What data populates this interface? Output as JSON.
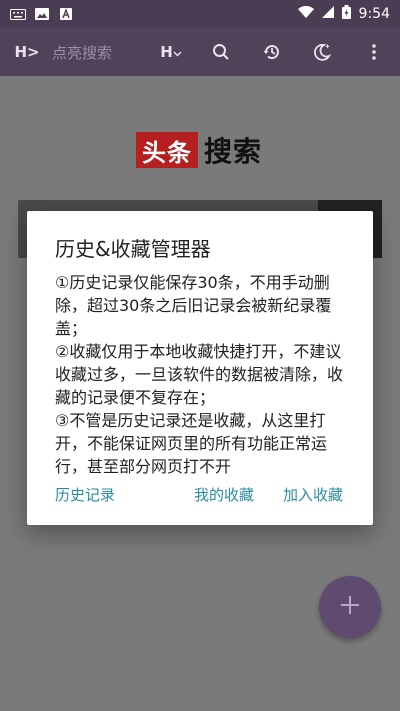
{
  "status_bar": {
    "time": "9:54",
    "left_icons": [
      "keyboard-icon",
      "image-icon",
      "text-a-icon"
    ],
    "right_icons": [
      "wifi-icon",
      "signal-icon",
      "battery-charging-icon"
    ]
  },
  "toolbar": {
    "site_button_label": "H>",
    "search_placeholder": "点亮搜索",
    "heading_button_label": "H",
    "icons": [
      "search-icon",
      "history-icon",
      "night-mode-icon",
      "more-icon"
    ]
  },
  "main": {
    "logo_box": "头条",
    "logo_text": "搜索"
  },
  "dialog": {
    "title": "历史&收藏管理器",
    "body": "①历史记录仅能保存30条，不用手动删除，超过30条之后旧记录会被新纪录覆盖；\n②收藏仅用于本地收藏快捷打开，不建议收藏过多，一旦该软件的数据被清除，收藏的记录便不复存在；\n③不管是历史记录还是收藏，从这里打开，不能保证网页里的所有功能正常运行，甚至部分网页打不开",
    "buttons": {
      "history": "历史记录",
      "favorites": "我的收藏",
      "add_favorite": "加入收藏"
    }
  },
  "colors": {
    "status_bar": "#4a3d53",
    "toolbar": "#514159",
    "accent": "#2a8fa0",
    "logo_red": "#b51f1f",
    "fab": "#5f4a70"
  }
}
